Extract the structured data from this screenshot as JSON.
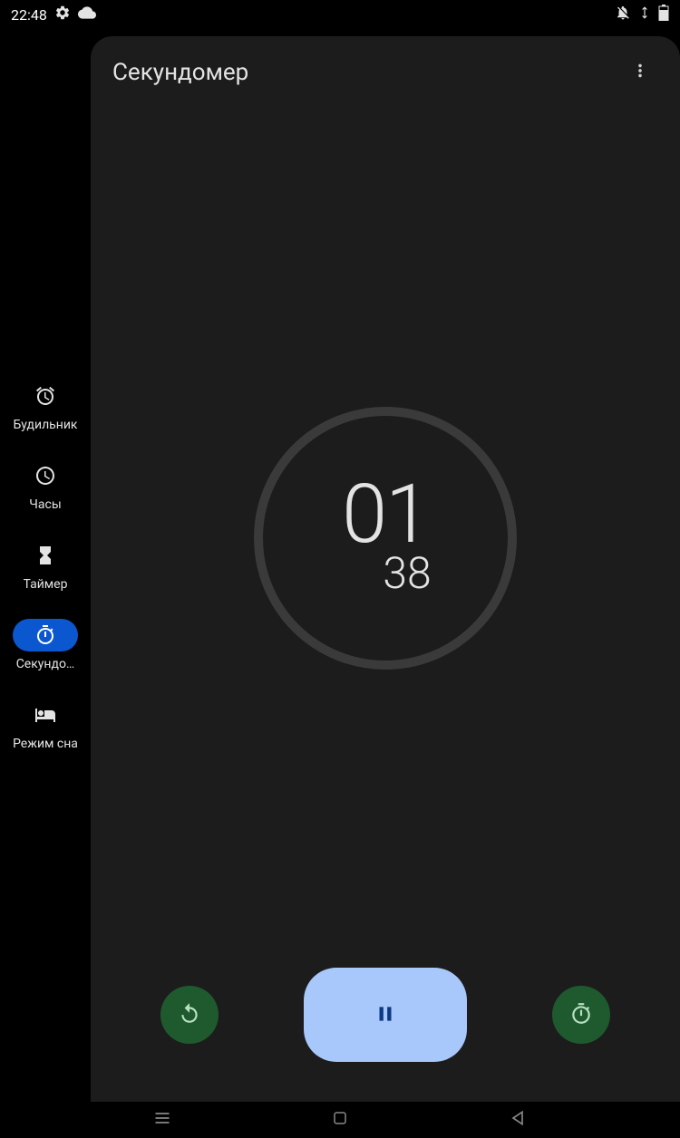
{
  "status": {
    "time": "22:48"
  },
  "sidebar": {
    "items": [
      {
        "label": "Будильник",
        "icon": "alarm"
      },
      {
        "label": "Часы",
        "icon": "clock"
      },
      {
        "label": "Таймер",
        "icon": "hourglass"
      },
      {
        "label": "Секундо…",
        "icon": "stopwatch",
        "active": true
      },
      {
        "label": "Режим сна",
        "icon": "bed"
      }
    ]
  },
  "header": {
    "title": "Секундомер"
  },
  "stopwatch": {
    "seconds": "01",
    "hundredths": "38"
  }
}
